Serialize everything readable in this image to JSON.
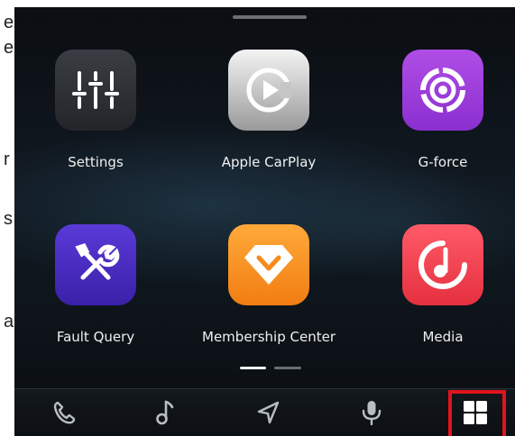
{
  "left_fragments": [
    "e",
    "e",
    "r",
    "s",
    "a"
  ],
  "apps": [
    {
      "label": "Settings",
      "icon": "equalizer-sliders-icon"
    },
    {
      "label": "Apple CarPlay",
      "icon": "carplay-play-icon"
    },
    {
      "label": "G-force",
      "icon": "target-ring-icon"
    },
    {
      "label": "Fault Query",
      "icon": "tools-wrench-screwdriver-icon"
    },
    {
      "label": "Membership Center",
      "icon": "diamond-icon"
    },
    {
      "label": "Media",
      "icon": "music-note-disc-icon"
    }
  ],
  "pagination": {
    "pages": 2,
    "current": 1
  },
  "dock": [
    {
      "icon": "phone-icon"
    },
    {
      "icon": "music-note-icon"
    },
    {
      "icon": "navigation-arrow-icon"
    },
    {
      "icon": "microphone-icon"
    },
    {
      "icon": "app-grid-icon"
    }
  ],
  "colors": {
    "settings": "#2b2d31",
    "carplay": "#c8c8c8",
    "gforce": "#9b3ddb",
    "fault_query": "#4a2ec0",
    "membership": "#f89022",
    "media": "#f04352",
    "highlight": "#e0141c"
  }
}
